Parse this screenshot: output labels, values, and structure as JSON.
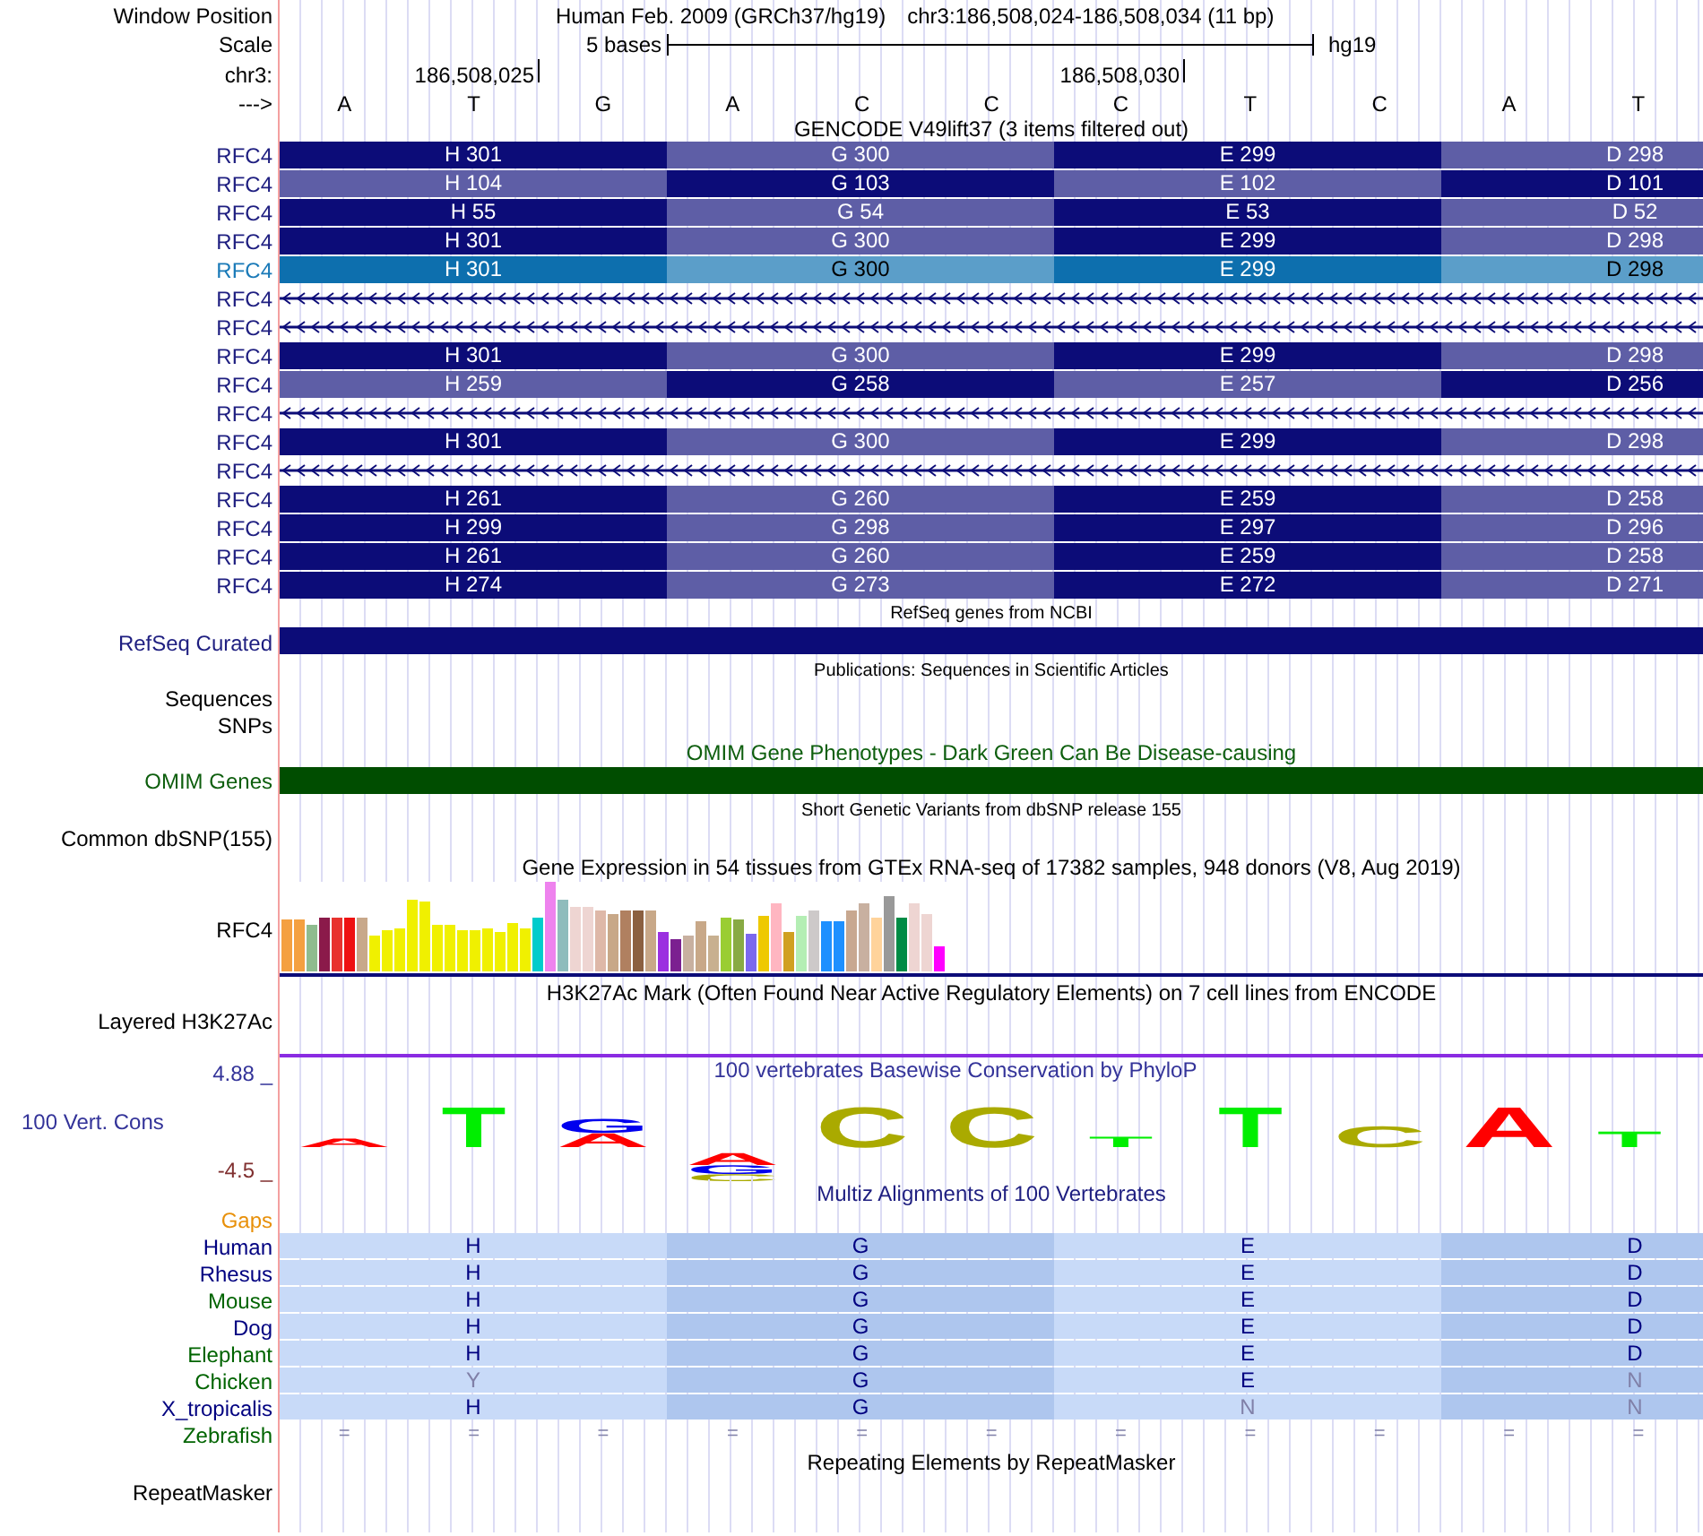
{
  "header": {
    "window_position_label": "Window Position",
    "assembly": "Human Feb. 2009 (GRCh37/hg19)",
    "range": "chr3:186,508,024-186,508,034 (11 bp)",
    "scale_label": "Scale",
    "scale_text": "5 bases",
    "scale_db": "hg19",
    "chrom_label": "chr3:",
    "positions": [
      "186,508,025",
      "186,508,030"
    ],
    "strand_label": "--->",
    "bases": [
      "A",
      "T",
      "G",
      "A",
      "C",
      "C",
      "C",
      "T",
      "C",
      "A",
      "T"
    ]
  },
  "gencode": {
    "title": "GENCODE V49lift37 (3 items filtered out)",
    "rows": [
      {
        "label": "RFC4",
        "kind": "exon",
        "highlighted": false,
        "cells": [
          {
            "text": "H 301",
            "dark": true
          },
          {
            "text": "G 300",
            "dark": false
          },
          {
            "text": "E 299",
            "dark": true
          },
          {
            "text": "D 298",
            "dark": false
          }
        ]
      },
      {
        "label": "RFC4",
        "kind": "exon",
        "highlighted": false,
        "cells": [
          {
            "text": "H 104",
            "dark": false
          },
          {
            "text": "G 103",
            "dark": true
          },
          {
            "text": "E 102",
            "dark": false
          },
          {
            "text": "D 101",
            "dark": true
          }
        ]
      },
      {
        "label": "RFC4",
        "kind": "exon",
        "highlighted": false,
        "cells": [
          {
            "text": "H 55",
            "dark": true
          },
          {
            "text": "G 54",
            "dark": false
          },
          {
            "text": "E 53",
            "dark": true
          },
          {
            "text": "D 52",
            "dark": false
          }
        ]
      },
      {
        "label": "RFC4",
        "kind": "exon",
        "highlighted": false,
        "cells": [
          {
            "text": "H 301",
            "dark": true
          },
          {
            "text": "G 300",
            "dark": false
          },
          {
            "text": "E 299",
            "dark": true
          },
          {
            "text": "D 298",
            "dark": false
          }
        ]
      },
      {
        "label": "RFC4",
        "kind": "exon",
        "highlighted": true,
        "cells": [
          {
            "text": "H 301",
            "dark": true
          },
          {
            "text": "G 300",
            "dark": false
          },
          {
            "text": "E 299",
            "dark": true
          },
          {
            "text": "D 298",
            "dark": false
          }
        ]
      },
      {
        "label": "RFC4",
        "kind": "intron",
        "highlighted": false
      },
      {
        "label": "RFC4",
        "kind": "intron",
        "highlighted": false
      },
      {
        "label": "RFC4",
        "kind": "exon",
        "highlighted": false,
        "cells": [
          {
            "text": "H 301",
            "dark": true
          },
          {
            "text": "G 300",
            "dark": false
          },
          {
            "text": "E 299",
            "dark": true
          },
          {
            "text": "D 298",
            "dark": false
          }
        ]
      },
      {
        "label": "RFC4",
        "kind": "exon",
        "highlighted": false,
        "cells": [
          {
            "text": "H 259",
            "dark": false
          },
          {
            "text": "G 258",
            "dark": true
          },
          {
            "text": "E 257",
            "dark": false
          },
          {
            "text": "D 256",
            "dark": true
          }
        ]
      },
      {
        "label": "RFC4",
        "kind": "intron",
        "highlighted": false
      },
      {
        "label": "RFC4",
        "kind": "exon",
        "highlighted": false,
        "cells": [
          {
            "text": "H 301",
            "dark": true
          },
          {
            "text": "G 300",
            "dark": false
          },
          {
            "text": "E 299",
            "dark": true
          },
          {
            "text": "D 298",
            "dark": false
          }
        ]
      },
      {
        "label": "RFC4",
        "kind": "intron",
        "highlighted": false
      },
      {
        "label": "RFC4",
        "kind": "exon",
        "highlighted": false,
        "cells": [
          {
            "text": "H 261",
            "dark": true
          },
          {
            "text": "G 260",
            "dark": false
          },
          {
            "text": "E 259",
            "dark": true
          },
          {
            "text": "D 258",
            "dark": false
          }
        ]
      },
      {
        "label": "RFC4",
        "kind": "exon",
        "highlighted": false,
        "cells": [
          {
            "text": "H 299",
            "dark": true
          },
          {
            "text": "G 298",
            "dark": false
          },
          {
            "text": "E 297",
            "dark": true
          },
          {
            "text": "D 296",
            "dark": false
          }
        ]
      },
      {
        "label": "RFC4",
        "kind": "exon",
        "highlighted": false,
        "cells": [
          {
            "text": "H 261",
            "dark": true
          },
          {
            "text": "G 260",
            "dark": false
          },
          {
            "text": "E 259",
            "dark": true
          },
          {
            "text": "D 258",
            "dark": false
          }
        ]
      },
      {
        "label": "RFC4",
        "kind": "exon",
        "highlighted": false,
        "cells": [
          {
            "text": "H 274",
            "dark": true
          },
          {
            "text": "G 273",
            "dark": false
          },
          {
            "text": "E 272",
            "dark": true
          },
          {
            "text": "D 271",
            "dark": false
          }
        ]
      }
    ]
  },
  "refseq": {
    "title": "RefSeq genes from NCBI",
    "label": "RefSeq Curated"
  },
  "publications": {
    "title": "Publications: Sequences in Scientific Articles",
    "labels": [
      "Sequences",
      "SNPs"
    ]
  },
  "omim": {
    "title": "OMIM Gene Phenotypes - Dark Green Can Be Disease-causing",
    "label": "OMIM Genes"
  },
  "dbsnp": {
    "title": "Short Genetic Variants from dbSNP release 155",
    "label": "Common dbSNP(155)"
  },
  "gtex": {
    "title": "Gene Expression in 54 tissues from GTEx RNA-seq of 17382 samples, 948 donors (V8, Aug 2019)",
    "label": "RFC4"
  },
  "h3k27ac": {
    "title": "H3K27Ac Mark (Often Found Near Active Regulatory Elements) on 7 cell lines from ENCODE",
    "label": "Layered H3K27Ac"
  },
  "conservation": {
    "title": "100 vertebrates Basewise Conservation by PhyloP",
    "label": "100 Vert. Cons",
    "max": "4.88 _",
    "min": "-4.5 _",
    "logo": [
      {
        "letters": [
          {
            "letter": "A",
            "color": "#ff0000"
          }
        ]
      },
      {
        "letters": [
          {
            "letter": "T",
            "color": "#00ee00"
          }
        ]
      },
      {
        "letters": [
          {
            "letter": "G",
            "color": "#0000ee"
          },
          {
            "letter": "A",
            "color": "#ff0000"
          }
        ]
      },
      {
        "letters": [
          {
            "letter": "A",
            "color": "#ff0000"
          },
          {
            "letter": "G",
            "color": "#0000ee"
          },
          {
            "letter": "C",
            "color": "#aaaa00"
          }
        ]
      },
      {
        "letters": [
          {
            "letter": "C",
            "color": "#aaaa00"
          }
        ]
      },
      {
        "letters": [
          {
            "letter": "C",
            "color": "#aaaa00"
          }
        ]
      },
      {
        "letters": [
          {
            "letter": "T",
            "color": "#00ee00"
          }
        ]
      },
      {
        "letters": [
          {
            "letter": "T",
            "color": "#00ee00"
          }
        ]
      },
      {
        "letters": [
          {
            "letter": "C",
            "color": "#aaaa00"
          }
        ]
      },
      {
        "letters": [
          {
            "letter": "A",
            "color": "#ff0000"
          }
        ]
      },
      {
        "letters": [
          {
            "letter": "T",
            "color": "#00ee00"
          }
        ]
      }
    ]
  },
  "multiz": {
    "title": "Multiz Alignments of 100 Vertebrates",
    "gaps_label": "Gaps",
    "species": [
      {
        "name": "Human",
        "color": "#000080",
        "cells": [
          {
            "text": "H",
            "dim": false
          },
          {
            "text": "G",
            "dim": false
          },
          {
            "text": "E",
            "dim": false
          },
          {
            "text": "D",
            "dim": false
          }
        ]
      },
      {
        "name": "Rhesus",
        "color": "#000080",
        "cells": [
          {
            "text": "H",
            "dim": false
          },
          {
            "text": "G",
            "dim": false
          },
          {
            "text": "E",
            "dim": false
          },
          {
            "text": "D",
            "dim": false
          }
        ]
      },
      {
        "name": "Mouse",
        "color": "#006400",
        "cells": [
          {
            "text": "H",
            "dim": false
          },
          {
            "text": "G",
            "dim": false
          },
          {
            "text": "E",
            "dim": false
          },
          {
            "text": "D",
            "dim": false
          }
        ]
      },
      {
        "name": "Dog",
        "color": "#000080",
        "cells": [
          {
            "text": "H",
            "dim": false
          },
          {
            "text": "G",
            "dim": false
          },
          {
            "text": "E",
            "dim": false
          },
          {
            "text": "D",
            "dim": false
          }
        ]
      },
      {
        "name": "Elephant",
        "color": "#006400",
        "cells": [
          {
            "text": "H",
            "dim": false
          },
          {
            "text": "G",
            "dim": false
          },
          {
            "text": "E",
            "dim": false
          },
          {
            "text": "D",
            "dim": false
          }
        ]
      },
      {
        "name": "Chicken",
        "color": "#006400",
        "cells": [
          {
            "text": "Y",
            "dim": true
          },
          {
            "text": "G",
            "dim": false
          },
          {
            "text": "E",
            "dim": false
          },
          {
            "text": "N",
            "dim": true
          }
        ]
      },
      {
        "name": "X_tropicalis",
        "color": "#000080",
        "cells": [
          {
            "text": "H",
            "dim": false
          },
          {
            "text": "G",
            "dim": false
          },
          {
            "text": "N",
            "dim": true
          },
          {
            "text": "N",
            "dim": true
          }
        ]
      }
    ],
    "zebrafish": {
      "name": "Zebrafish",
      "color": "#006400",
      "marks": [
        "=",
        "=",
        "=",
        "=",
        "=",
        "=",
        "=",
        "=",
        "=",
        "=",
        "="
      ]
    }
  },
  "repeatmasker": {
    "title": "Repeating Elements by RepeatMasker",
    "label": "RepeatMasker"
  }
}
